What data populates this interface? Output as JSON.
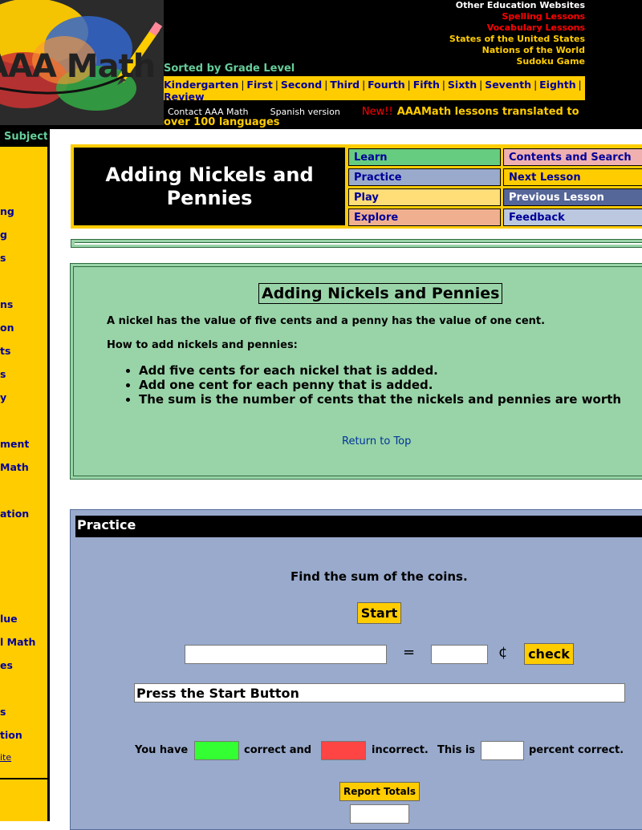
{
  "header": {
    "logo_text": "AAA Math",
    "external_links": [
      {
        "label": "Other Education Websites",
        "color": "#ffffff"
      },
      {
        "label": "Spelling Lessons",
        "color": "#ff0000"
      },
      {
        "label": "Vocabulary Lessons",
        "color": "#ff0000"
      },
      {
        "label": "States of the United States",
        "color": "#ffcc00"
      },
      {
        "label": "Nations of the World",
        "color": "#ffcc00"
      },
      {
        "label": "Sudoku Game",
        "color": "#ffcc00"
      }
    ],
    "grade_label": "Sorted by Grade Level",
    "grades": [
      "Kindergarten",
      "First",
      "Second",
      "Third",
      "Fourth",
      "Fifth",
      "Sixth",
      "Seventh",
      "Eighth"
    ],
    "review": "Review",
    "contact": "Contact AAA Math",
    "spanish": "Spanish version",
    "new_label": "New!!",
    "translated": "AAAMath lessons translated to",
    "translated_2": "over 100 languages"
  },
  "sidebar": {
    "heading": "Subject",
    "items": [
      "ng",
      "g",
      "s",
      "ns",
      "on",
      "ts",
      "s",
      "y",
      "ment",
      "Math",
      "ation",
      "lue",
      "l Math",
      "es",
      "s",
      "tion"
    ],
    "small_link": "ite"
  },
  "nav": {
    "lesson_title": "Adding Nickels and Pennies",
    "cells": [
      {
        "label": "Learn",
        "color": "#66cc80"
      },
      {
        "label": "Contents and Search",
        "color": "#f0b0b0"
      },
      {
        "label": "Practice",
        "color": "#99aacc"
      },
      {
        "label": "Next Lesson",
        "color": "#ffcc00"
      },
      {
        "label": "Play",
        "color": "#ffdd77"
      },
      {
        "label": "Previous Lesson",
        "color": "#556699"
      },
      {
        "label": "Explore",
        "color": "#f0b090"
      },
      {
        "label": "Feedback",
        "color": "#bbc8e0"
      }
    ]
  },
  "learn": {
    "heading": "Adding Nickels and Pennies",
    "intro": "A nickel has the value of five cents and a penny has the value of one cent.",
    "howto": "How to add nickels and pennies:",
    "steps": [
      "Add five cents for each nickel that is added.",
      "Add one cent for each penny that is added.",
      "The sum is the number of cents that the nickels and pennies are worth"
    ],
    "return_top": "Return to Top"
  },
  "practice": {
    "heading": "Practice",
    "prompt": "Find the sum of the coins.",
    "start_label": "Start",
    "equals": "=",
    "cent": "¢",
    "check_label": "check",
    "status": "Press the Start Button",
    "you_have": "You have",
    "correct_and": "correct and",
    "incorrect": "incorrect.",
    "this_is": "This is",
    "percent_correct": "percent correct.",
    "report_label": "Report Totals"
  }
}
